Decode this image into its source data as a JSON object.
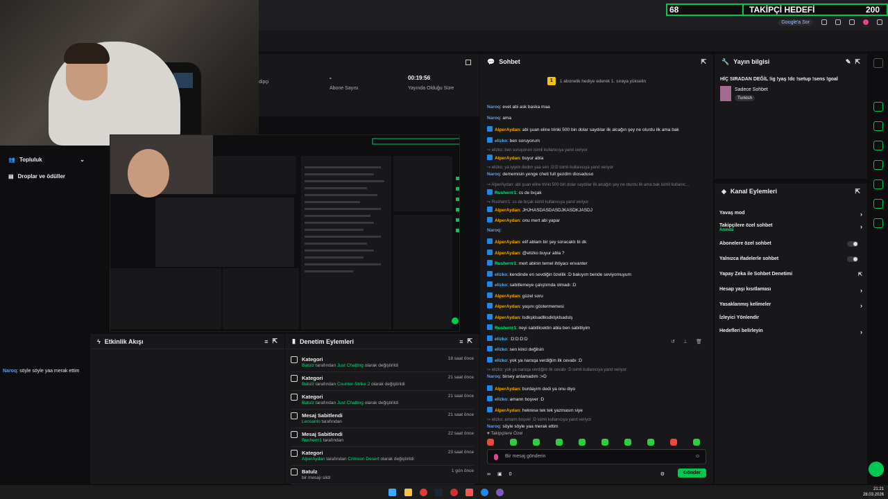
{
  "goal": {
    "current": "68",
    "title": "TAKİPÇİ HEDEFİ",
    "target": "200"
  },
  "browser": {
    "google_search": "Google'a Sor"
  },
  "stats": [
    {
      "value": "",
      "label": "dipçi"
    },
    {
      "value": "-",
      "label": "Abone Sayısı"
    },
    {
      "value": "00:19:56",
      "label": "Yayında Olduğu Süre"
    }
  ],
  "left_sidebar": {
    "community": "Topluluk",
    "drops": "Droplar ve ödüller"
  },
  "left_chat": {
    "user": "Naroq",
    "text": ": söyle söyle yaa merak ettim"
  },
  "activity": {
    "title": "Etkinlik Akışı"
  },
  "moderation": {
    "title": "Denetim Eylemleri",
    "rows": [
      {
        "title": "Kategori",
        "user": "Batulz",
        "mid": " tarafından ",
        "hl": "Just Chatting",
        "tail": " olarak değiştirildi",
        "time": "18 saat önce"
      },
      {
        "title": "Kategori",
        "user": "Batulz",
        "mid": " tarafından ",
        "hl": "Counter-Strike 2",
        "tail": " olarak değiştirildi",
        "time": "21 saat önce"
      },
      {
        "title": "Kategori",
        "user": "Batulz",
        "mid": " tarafından ",
        "hl": "Just Chatting",
        "tail": " olarak değiştirildi",
        "time": "21 saat önce"
      },
      {
        "title": "Mesaj Sabitlendi",
        "user": "Leosanto",
        "mid": " tarafından",
        "hl": "",
        "tail": "",
        "time": "21 saat önce"
      },
      {
        "title": "Mesaj Sabitlendi",
        "user": "Rusherrr1",
        "mid": " tarafından",
        "hl": "",
        "tail": "",
        "time": "22 saat önce"
      },
      {
        "title": "Kategori",
        "user": "AlperAydan",
        "mid": " tarafından ",
        "hl": "Crimson Desert",
        "tail": " olarak değiştirildi",
        "time": "23 saat önce"
      },
      {
        "title": "Batulz",
        "user": "",
        "mid": "bir mesajı sildi",
        "hl": "",
        "tail": "",
        "time": "1 gün önce"
      }
    ]
  },
  "chat": {
    "title": "Sohbet",
    "banner": "1 abonelik hediye ederek 1. sıraya yükselin",
    "messages": [
      {
        "user": "Naroq",
        "text": ": evet abi ask baska maa",
        "color": "c-blue",
        "badge": false,
        "reply": ""
      },
      {
        "user": "Naroq",
        "text": ": ama",
        "color": "c-blue",
        "badge": false,
        "reply": ""
      },
      {
        "user": "AlperAydan",
        "text": ": abi şuan eline trinki 500 bin dolar saydılar ilk alcağın şey ne olurdu ilk ama bak",
        "color": "c-gold",
        "badge": true,
        "reply": ""
      },
      {
        "user": "elizko",
        "text": ": ben soruyorum",
        "color": "c-teal",
        "badge": true,
        "reply": ""
      },
      {
        "user": "",
        "text": "",
        "color": "",
        "badge": false,
        "reply": "↪ elizko: ben soruyorum isimli kullanıcıya yanıt veriyor"
      },
      {
        "user": "AlperAydan",
        "text": ": buyur abla",
        "color": "c-gold",
        "badge": true,
        "reply": ""
      },
      {
        "user": "",
        "text": "",
        "color": "",
        "badge": false,
        "reply": "↪ elizko: ya iyiyim dedim yaa sen :D:D isimli kullanıcıya yanıt veriyor"
      },
      {
        "user": "Naroq",
        "text": ": dememisin yenge cheti full gezdim diosaduso",
        "color": "c-blue",
        "badge": false,
        "reply": ""
      },
      {
        "user": "",
        "text": "",
        "color": "",
        "badge": false,
        "reply": "↪ AlperAydan: abi şuan eline trinki 500 bin dolar saydılar ilk alcağın şey ne olurdu ilk ama bak isimli kullanıc..."
      },
      {
        "user": "Rusherrr1",
        "text": ": cs de bıçak",
        "color": "c-green",
        "badge": true,
        "reply": ""
      },
      {
        "user": "",
        "text": "",
        "color": "",
        "badge": false,
        "reply": "↪ Rusherrr1: cs de bıçak isimli kullanıcıya yanıt veriyor"
      },
      {
        "user": "AlperAydan",
        "text": ": JHJHASDASDASDJKASDKJASDJ",
        "color": "c-gold",
        "badge": true,
        "reply": ""
      },
      {
        "user": "AlperAydan",
        "text": ": onu mert abi yapar",
        "color": "c-gold",
        "badge": true,
        "reply": ""
      },
      {
        "user": "Naroq",
        "text": ":",
        "color": "c-blue",
        "badge": false,
        "reply": ""
      },
      {
        "user": "AlperAydan",
        "text": ": elif ablam bir şey soracaktı bi dk",
        "color": "c-gold",
        "badge": true,
        "reply": ""
      },
      {
        "user": "AlperAydan",
        "text": ": @elizko buyur abla ?",
        "color": "c-gold",
        "badge": true,
        "reply": ""
      },
      {
        "user": "Rusherrr1",
        "text": ": mert abinin temel ihtiyacı envanter",
        "color": "c-green",
        "badge": true,
        "reply": ""
      },
      {
        "user": "elizko",
        "text": ": kendinde en sevdiğin özellik :D bakıyım bende seviyomuyum",
        "color": "c-teal",
        "badge": true,
        "reply": ""
      },
      {
        "user": "elizko",
        "text": ": sabitlemeye çalıştımda olmadı :D",
        "color": "c-teal",
        "badge": true,
        "reply": ""
      },
      {
        "user": "AlperAydan",
        "text": ": güzel soru",
        "color": "c-gold",
        "badge": true,
        "reply": ""
      },
      {
        "user": "AlperAydan",
        "text": ": yaşını göstermemesi",
        "color": "c-gold",
        "badge": true,
        "reply": ""
      },
      {
        "user": "AlperAydan",
        "text": ": lsdkşklsadlksdklşklsadslş",
        "color": "c-gold",
        "badge": true,
        "reply": ""
      },
      {
        "user": "Rusherrr1",
        "text": ": neyi sabitlicektin abla ben sabitliyim",
        "color": "c-green",
        "badge": true,
        "reply": ""
      },
      {
        "user": "elizko",
        "text": ": :D:D:D:D",
        "color": "c-teal",
        "badge": true,
        "reply": ""
      },
      {
        "user": "elizko",
        "text": ": sen kinci değilsin",
        "color": "c-teal",
        "badge": true,
        "reply": ""
      },
      {
        "user": "elizko",
        "text": ": yok ya naroqa verdiğim ilk cevabı :D",
        "color": "c-teal",
        "badge": true,
        "reply": ""
      },
      {
        "user": "",
        "text": "",
        "color": "",
        "badge": false,
        "reply": "↪ elizko: yok ya naroqa verdiğim ilk cevabı :D isimli kullanıcıya yanıt veriyor"
      },
      {
        "user": "Naroq",
        "text": ": birsey anlamadım :>D",
        "color": "c-blue",
        "badge": false,
        "reply": ""
      },
      {
        "user": "AlperAydan",
        "text": ": burdayım dedi ya onu diyo",
        "color": "c-gold",
        "badge": true,
        "reply": ""
      },
      {
        "user": "elizko",
        "text": ": amann boşver :D",
        "color": "c-teal",
        "badge": true,
        "reply": ""
      },
      {
        "user": "AlperAydan",
        "text": ": hekrese tek tek yazmasın siye",
        "color": "c-gold",
        "badge": true,
        "reply": ""
      },
      {
        "user": "",
        "text": "",
        "color": "",
        "badge": false,
        "reply": "↪ elizko: amann boşver :D isimli kullanıcıya yanıt veriyor"
      },
      {
        "user": "Naroq",
        "text": ": söyle söyle yaa merak ettim",
        "color": "c-blue",
        "badge": false,
        "reply": ""
      }
    ],
    "followers_only": "♥ Takipçilere Özel",
    "input_placeholder": "Bir mesaj gönderin",
    "viewer_count": "0",
    "send": "Gönder",
    "infinity": "∞"
  },
  "stream_info": {
    "title": "Yayın bilgisi",
    "stream_title": "HİÇ SIRADAN DEĞİL !ig !yaş !dc !setup !sens !goal",
    "category": "Sadece Sohbet",
    "tag": "Turkish"
  },
  "channel_actions": {
    "title": "Kanal Eylemleri",
    "items": [
      {
        "label": "Yavaş mod",
        "sub": "",
        "kind": "chevron"
      },
      {
        "label": "Takipçilere özel sohbet",
        "sub": "Anında",
        "kind": "chevron"
      },
      {
        "label": "Abonelere özel sohbet",
        "sub": "",
        "kind": "toggle"
      },
      {
        "label": "Yalnızca ifadelerle sohbet",
        "sub": "",
        "kind": "toggle"
      },
      {
        "label": "Yapay Zeka ile Sohbet Denetimi",
        "sub": "",
        "kind": "external"
      },
      {
        "label": "Hesap yaşı kısıtlaması",
        "sub": "",
        "kind": "chevron"
      },
      {
        "label": "Yasaklanmış kelimeler",
        "sub": "",
        "kind": "chevron"
      },
      {
        "label": "İzleyici Yönlendir",
        "sub": "",
        "kind": "none"
      },
      {
        "label": "Hedefleri belirleyin",
        "sub": "",
        "kind": "chevron"
      }
    ]
  },
  "clock": {
    "time": "21:21",
    "date": "28.03.2026"
  }
}
